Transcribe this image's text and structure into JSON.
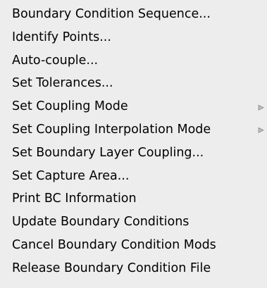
{
  "menu": {
    "items": [
      {
        "label": "Boundary Condition Sequence...",
        "submenu": false
      },
      {
        "label": "Identify Points...",
        "submenu": false
      },
      {
        "label": "Auto-couple...",
        "submenu": false
      },
      {
        "label": "Set Tolerances...",
        "submenu": false
      },
      {
        "label": "Set Coupling Mode",
        "submenu": true
      },
      {
        "label": "Set Coupling Interpolation Mode",
        "submenu": true
      },
      {
        "label": "Set Boundary Layer Coupling...",
        "submenu": false
      },
      {
        "label": "Set Capture Area...",
        "submenu": false
      },
      {
        "label": "Print BC Information",
        "submenu": false
      },
      {
        "label": "Update Boundary Conditions",
        "submenu": false
      },
      {
        "label": "Cancel Boundary Condition Mods",
        "submenu": false
      },
      {
        "label": "Release Boundary Condition File",
        "submenu": false
      }
    ],
    "submenu_icon": "chevron-right-icon",
    "colors": {
      "background": "#ededed",
      "text": "#000000",
      "arrow": "#9a9a9a"
    }
  }
}
